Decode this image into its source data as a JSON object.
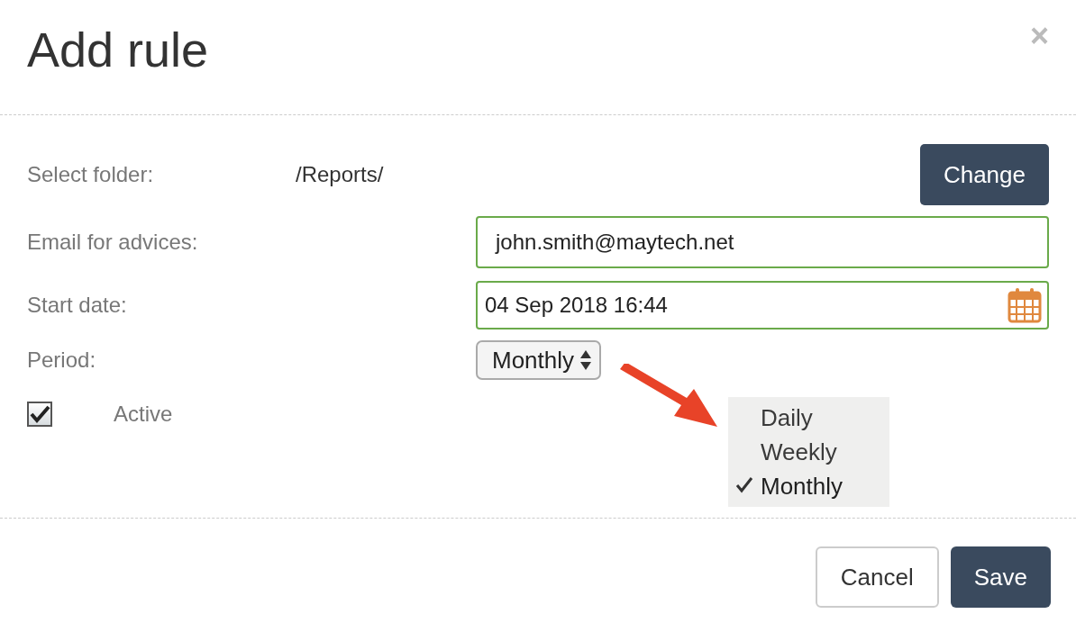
{
  "dialog": {
    "title": "Add rule",
    "close": "×"
  },
  "folder": {
    "label": "Select folder:",
    "value": "/Reports/",
    "button": "Change"
  },
  "email": {
    "label": "Email for advices:",
    "value": "john.smith@maytech.net"
  },
  "start_date": {
    "label": "Start date:",
    "value": "04 Sep 2018 16:44"
  },
  "period": {
    "label": "Period:",
    "value": "Monthly",
    "options": [
      {
        "label": "Daily",
        "selected": false
      },
      {
        "label": "Weekly",
        "selected": false
      },
      {
        "label": "Monthly",
        "selected": true
      }
    ]
  },
  "active": {
    "label": "Active",
    "checked": true
  },
  "buttons": [
    {
      "label": "Cancel",
      "kind": "secondary"
    },
    {
      "label": "Save",
      "kind": "primary"
    }
  ]
}
